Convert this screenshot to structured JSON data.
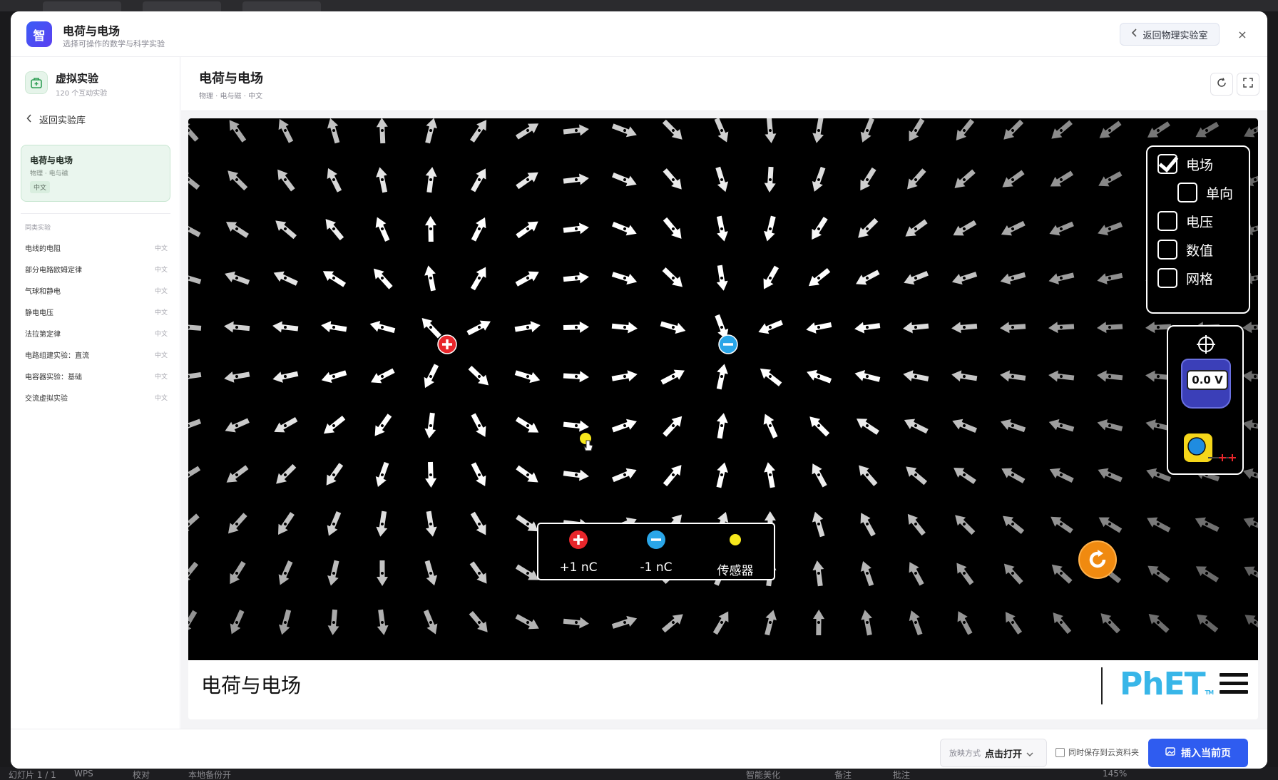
{
  "modal": {
    "logo_text": "智",
    "title": "电荷与电场",
    "subtitle": "选择可操作的数学与科学实验",
    "back_lab_label": "返回物理实验室",
    "close_label": "×"
  },
  "sidebar": {
    "title": "虚拟实验",
    "count": "120 个互动实验",
    "back_label": "返回实验库",
    "current": {
      "title": "电荷与电场",
      "meta": "物理 · 电与磁",
      "tag": "中文"
    },
    "section_title": "同类实验",
    "items": [
      {
        "label": "电线的电阻",
        "lang": "中文"
      },
      {
        "label": "部分电路欧姆定律",
        "lang": "中文"
      },
      {
        "label": "气球和静电",
        "lang": "中文"
      },
      {
        "label": "静电电压",
        "lang": "中文"
      },
      {
        "label": "法拉第定律",
        "lang": "中文"
      },
      {
        "label": "电路组建实验：直流",
        "lang": "中文"
      },
      {
        "label": "电容器实验：基础",
        "lang": "中文"
      },
      {
        "label": "交流虚拟实验",
        "lang": "中文"
      }
    ]
  },
  "main": {
    "title": "电荷与电场",
    "meta": "物理 · 电与磁 · 中文"
  },
  "sim": {
    "controls": {
      "electric_field": "电场",
      "direction_only": "单向",
      "voltage": "电压",
      "values": "数值",
      "grid": "网格",
      "electric_field_checked": true,
      "direction_only_checked": false,
      "voltage_checked": false,
      "values_checked": false,
      "grid_checked": false
    },
    "voltmeter_value": "0.0 V",
    "charges": {
      "positive_label": "+1 nC",
      "negative_label": "-1 nC",
      "sensor_label": "传感器"
    },
    "footer_title": "电荷与电场",
    "logo_text": "PhET",
    "logo_tm": "TM"
  },
  "footer": {
    "play_mode_key": "放映方式",
    "play_mode_value": "点击打开",
    "save_cloud_label": "同时保存到云资料夹",
    "insert_label": "插入当前页"
  },
  "desktop": {
    "status_left": "幻灯片 1 / 1",
    "status_wps": "WPS",
    "status_proof": "校对",
    "status_backup": "本地备份开",
    "status_beautify": "智能美化",
    "status_notes": "备注",
    "status_comments": "批注",
    "status_zoom": "145%"
  },
  "colors": {
    "accent": "#2f5cf0",
    "positive_charge": "#e8262b",
    "negative_charge": "#2aa6e8",
    "sensor": "#f7e81c",
    "reset": "#f08a10"
  }
}
